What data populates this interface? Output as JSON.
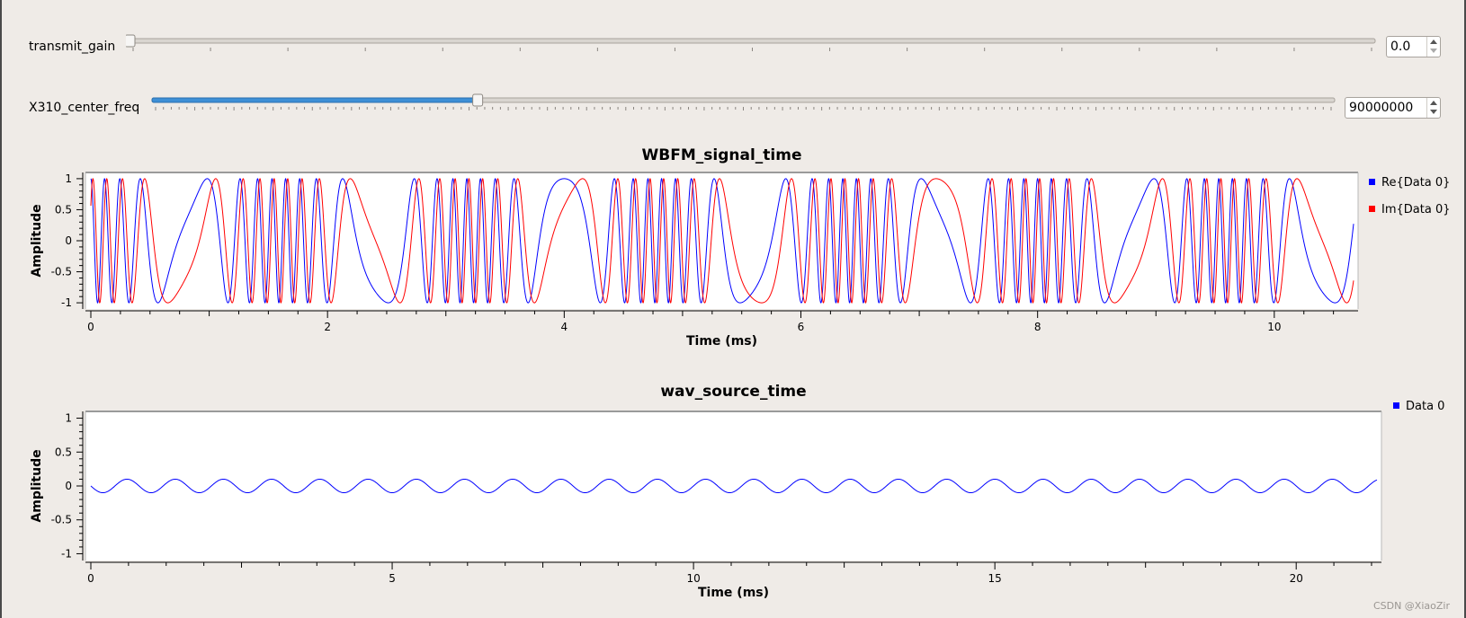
{
  "controls": {
    "transmit_gain": {
      "label": "transmit_gain",
      "value": "0.0",
      "level": 0.0
    },
    "center_freq": {
      "label": "X310_center_freq",
      "value": "90000000",
      "level": 0.275
    }
  },
  "colors": {
    "blue": "#0000ff",
    "red": "#ff0000",
    "slider_fill": "#3d8fd6"
  },
  "chart_data": [
    {
      "type": "line",
      "title": "WBFM_signal_time",
      "xlabel": "Time (ms)",
      "ylabel": "Amplitude",
      "xlim": [
        0,
        10.67
      ],
      "ylim": [
        -1.1,
        1.1
      ],
      "xticks": [
        0,
        2,
        4,
        6,
        8,
        10
      ],
      "yticks": [
        1,
        0.5,
        0,
        -0.5,
        -1
      ],
      "grid": false,
      "legend": "right",
      "series": [
        {
          "name": "Re{Data 0}",
          "color": "#0000ff",
          "signal": "cos(phase)",
          "carrier_khz": 4.75,
          "deviation_khz": 4.0,
          "mod_khz": 0.625
        },
        {
          "name": "Im{Data 0}",
          "color": "#ff0000",
          "signal": "sin(phase)",
          "carrier_khz": 4.75,
          "deviation_khz": 4.0,
          "mod_khz": 0.625
        }
      ]
    },
    {
      "type": "line",
      "title": "wav_source_time",
      "xlabel": "Time (ms)",
      "ylabel": "Amplitude",
      "xlim": [
        0,
        21.34
      ],
      "ylim": [
        -1.1,
        1.1
      ],
      "xticks": [
        0,
        5,
        10,
        15,
        20
      ],
      "yticks": [
        1,
        0.5,
        0,
        -0.5,
        -1
      ],
      "grid": false,
      "legend": "right",
      "series": [
        {
          "name": "Data 0",
          "color": "#0000ff",
          "signal": "sine",
          "amplitude": 0.1,
          "freq_khz": 1.25
        }
      ]
    }
  ],
  "watermark": "CSDN @XiaoZir"
}
